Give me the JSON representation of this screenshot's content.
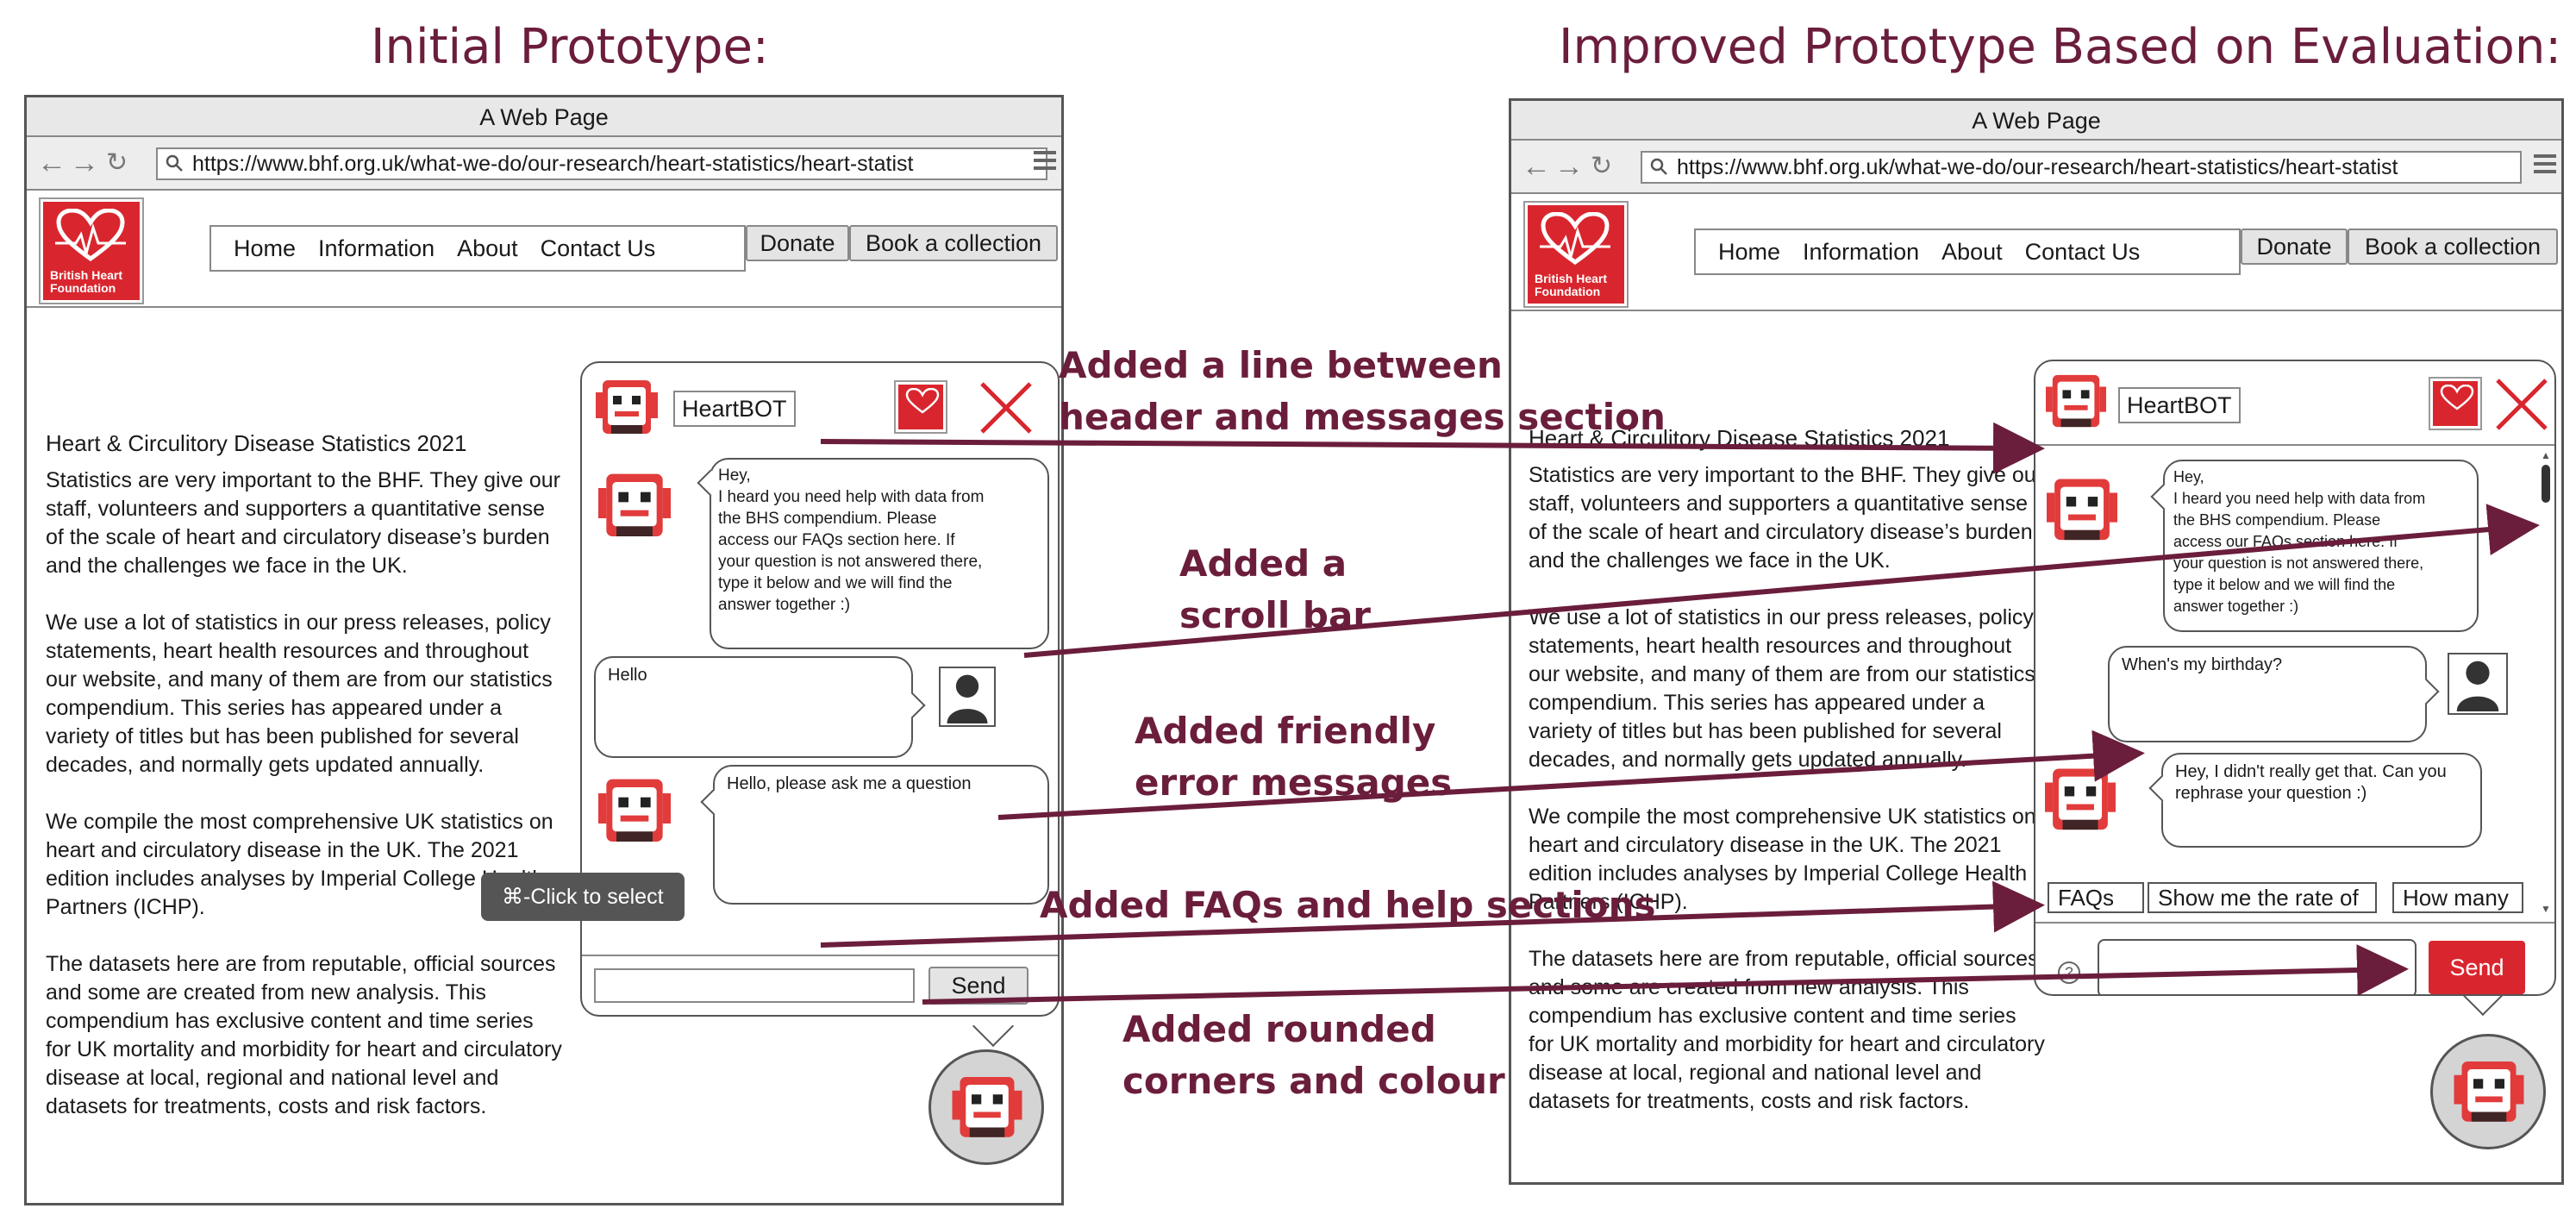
{
  "headings": {
    "left": "Initial Prototype:",
    "right": "Improved Prototype Based on Evaluation:"
  },
  "browser": {
    "title": "A Web Page",
    "url": "https://www.bhf.org.uk/what-we-do/our-research/heart-statistics/heart-statist",
    "logo_text": [
      "British Heart",
      "Foundation"
    ],
    "nav": [
      "Home",
      "Information",
      "About",
      "Contact Us"
    ],
    "donate_label": "Donate",
    "book_label": "Book a collection",
    "icons": {
      "back": "arrow-left-icon",
      "forward": "arrow-right-icon",
      "reload": "reload-icon",
      "search": "search-icon",
      "menu": "hamburger-menu-icon"
    }
  },
  "page": {
    "title": "Heart & Circulitory Disease Statistics 2021",
    "left_paragraphs": [
      [
        "Statistics are very important to the BHF. They give our",
        "staff, volunteers and supporters a quantitative sense",
        "of the scale of heart and circulatory disease’s burden",
        "and the challenges we face in the UK."
      ],
      [
        "We use a lot of statistics in our press releases, policy",
        "statements, heart health resources and throughout",
        "our website, and many of them are from our statistics",
        "compendium. This series has appeared under a",
        "variety of titles but has been published for several",
        "decades, and normally gets updated annually."
      ],
      [
        "We compile the most comprehensive UK statistics on",
        "heart and circulatory disease in the UK. The 2021",
        "edition includes analyses by Imperial College Health",
        "Partners (ICHP)."
      ],
      [
        "The datasets here are from reputable, official sources",
        "and some are created from new analysis. This",
        "compendium has exclusive content and time series",
        "for UK mortality and morbidity for heart and circulatory",
        "disease at local, regional and national level and",
        "datasets for treatments, costs and risk factors."
      ]
    ],
    "right_paragraphs": [
      [
        "Statistics are very important to the BHF. They give our",
        "staff, volunteers and supporters a quantitative sense",
        "of the scale of heart and circulatory disease’s burden",
        "and the challenges we face in the UK."
      ],
      [
        "We use a lot of statistics in our press releases, policy",
        "statements, heart health resources and throughout",
        "our website, and many of them are from our statistics",
        "compendium. This series has appeared under a",
        "variety of titles but has been published for several",
        "decades, and normally gets updated annually."
      ],
      [
        "We compile the most comprehensive UK statistics on",
        "heart and circulatory disease in the UK. The 2021",
        "edition includes analyses by Imperial College Health",
        "Partners (ICHP)."
      ],
      [
        "The datasets here are from reputable, official sources",
        "and some are created from new analysis. This",
        "compendium has exclusive content and time series",
        "for UK mortality and morbidity for heart and circulatory",
        "disease at local, regional and national level and",
        "datasets for treatments, costs and risk factors."
      ]
    ]
  },
  "chat": {
    "bot_name": "HeartBOT",
    "greeting": [
      "Hey,",
      "I heard you need help with data from",
      "the BHS compendium. Please",
      "access our FAQs section here. If",
      "your question is not answered there,",
      "type it below and we will find the",
      "answer together :)"
    ],
    "left_user_msg": "Hello",
    "left_bot_reply": "Hello, please ask me a question",
    "right_user_msg": "When's my birthday?",
    "right_bot_reply": [
      "Hey, I didn't really get that. Can you",
      "rephrase your question :)"
    ],
    "send_label": "Send",
    "faq_chips": [
      "FAQs",
      "Show me the rate of",
      "How many"
    ],
    "help_glyph": "?",
    "tooltip": "⌘-Click to select",
    "colors": {
      "send_red": "#d9262e",
      "bot_red": "#e23b3b"
    }
  },
  "annotations": [
    [
      "Added a line between",
      "header and messages section"
    ],
    [
      "Added a",
      "scroll bar"
    ],
    [
      "Added friendly",
      "error messages"
    ],
    [
      "Added FAQs and help sections"
    ],
    [
      "Added rounded",
      "corners and colour"
    ]
  ],
  "colors": {
    "annotation": "#6b1d3c",
    "heading": "#6b1d3c",
    "bhf_red": "#d9262e"
  }
}
